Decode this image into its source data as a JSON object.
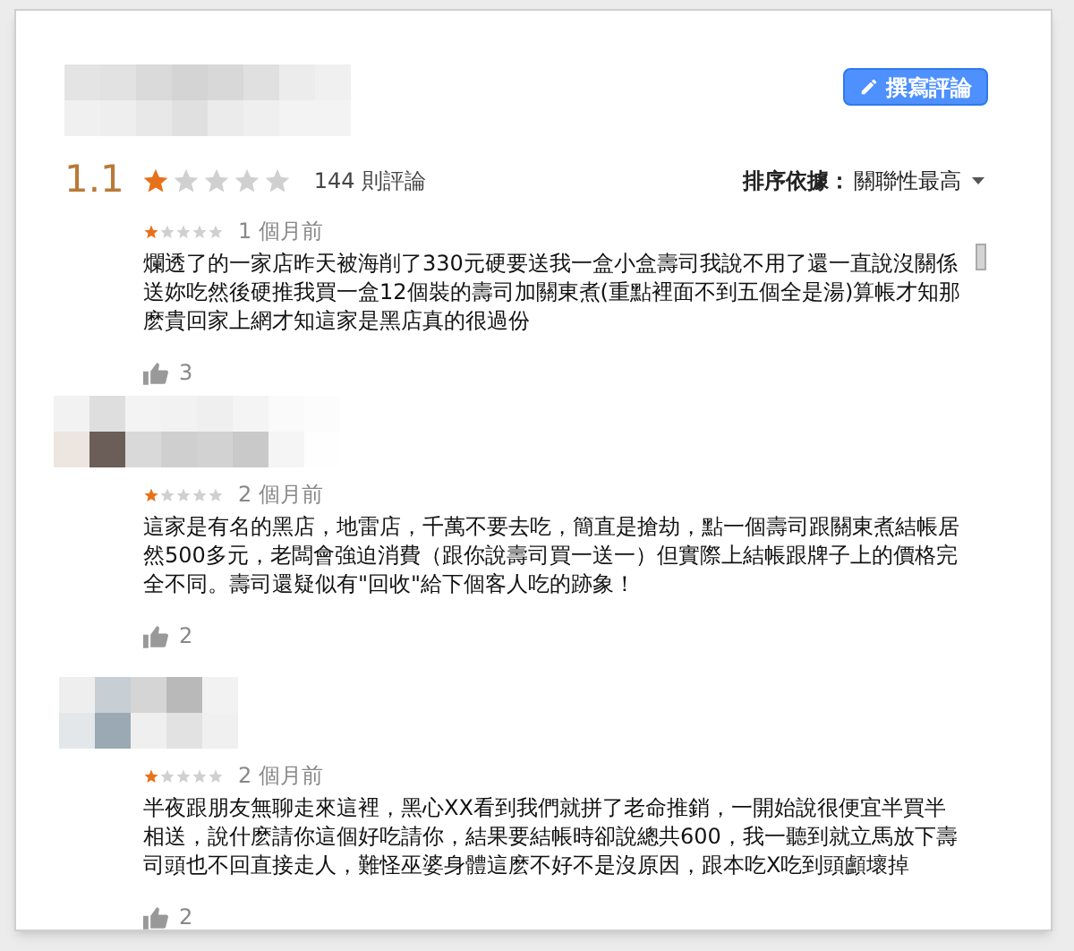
{
  "header": {
    "write_review_button": "撰寫評論"
  },
  "summary": {
    "rating": "1.1",
    "stars": 1,
    "review_count": "144 則評論",
    "sort_label": "排序依據：",
    "sort_value": "關聯性最高"
  },
  "reviews": [
    {
      "stars": 1,
      "time": "1 個月前",
      "text": "爛透了的一家店昨天被海削了330元硬要送我一盒小盒壽司我說不用了還一直說沒關係送妳吃然後硬推我買一盒12個裝的壽司加關東煮(重點裡面不到五個全是湯)算帳才知那麽貴回家上網才知這家是黑店真的很過份",
      "likes": "3"
    },
    {
      "stars": 1,
      "time": "2 個月前",
      "text": "這家是有名的黑店，地雷店，千萬不要去吃，簡直是搶劫，點一個壽司跟關東煮結帳居然500多元，老闆會強迫消費（跟你說壽司買一送一）但實際上結帳跟牌子上的價格完全不同。壽司還疑似有\"回收\"給下個客人吃的跡象！",
      "likes": "2"
    },
    {
      "stars": 1,
      "time": "2 個月前",
      "text": "半夜跟朋友無聊走來這裡，黑心XX看到我們就拼了老命推銷，一開始說很便宜半買半相送，說什麽請你這個好吃請你，結果要結帳時卻說總共600，我一聽到就立馬放下壽司頭也不回直接走人，難怪巫婆身體這麽不好不是沒原因，跟本吃X吃到頭顱壞掉",
      "likes": "2"
    }
  ]
}
